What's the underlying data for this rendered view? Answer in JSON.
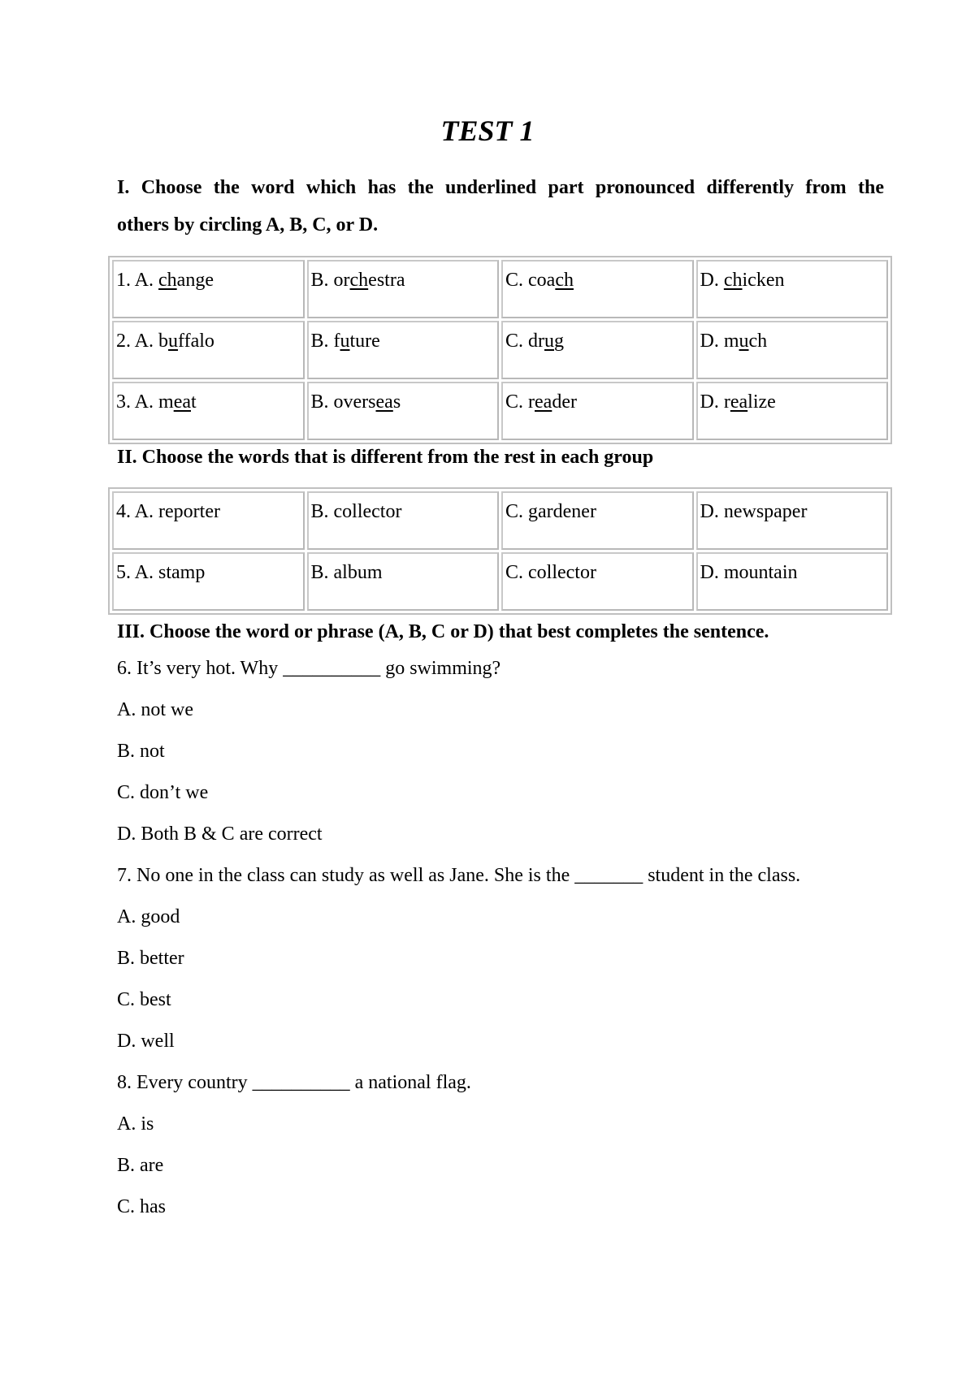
{
  "title": "TEST 1",
  "section1": {
    "heading_line1": "I. Choose the word which has the underlined part pronounced differently from the",
    "heading_line2": "others by circling A, B, C, or D.",
    "rows": [
      [
        {
          "prefix": "1. A. ",
          "pre": "",
          "u": "ch",
          "post": "ange"
        },
        {
          "prefix": "B. ",
          "pre": "or",
          "u": "ch",
          "post": "estra"
        },
        {
          "prefix": "C. ",
          "pre": "coa",
          "u": "ch",
          "post": ""
        },
        {
          "prefix": "D. ",
          "pre": "",
          "u": "ch",
          "post": "icken"
        }
      ],
      [
        {
          "prefix": "2. A. ",
          "pre": "b",
          "u": "u",
          "post": "ffalo"
        },
        {
          "prefix": "B. ",
          "pre": "f",
          "u": "u",
          "post": "ture"
        },
        {
          "prefix": "C. ",
          "pre": "dr",
          "u": "u",
          "post": "g"
        },
        {
          "prefix": "D. ",
          "pre": "m",
          "u": "u",
          "post": "ch"
        }
      ],
      [
        {
          "prefix": "3. A. ",
          "pre": "m",
          "u": "ea",
          "post": "t"
        },
        {
          "prefix": "B. ",
          "pre": "overs",
          "u": "ea",
          "post": "s"
        },
        {
          "prefix": "C. ",
          "pre": "r",
          "u": "ea",
          "post": "der"
        },
        {
          "prefix": "D. ",
          "pre": "r",
          "u": "ea",
          "post": "lize"
        }
      ]
    ]
  },
  "section2": {
    "heading": "II. Choose the words that is different from the rest in each group",
    "rows": [
      [
        "4. A. reporter",
        "B. collector",
        "C. gardener",
        "D. newspaper"
      ],
      [
        "5. A. stamp",
        "B. album",
        "C. collector",
        "D. mountain"
      ]
    ]
  },
  "section3": {
    "heading": "III. Choose the word or phrase (A, B, C or D) that best completes the sentence.",
    "lines": [
      "6. It’s very hot. Why __________ go swimming?",
      "A. not we",
      "B. not",
      "C. don’t we",
      "D. Both B & C are correct",
      "7. No one in the class can study as well as Jane. She is the _______ student in the class.",
      "A. good",
      "B. better",
      "C. best",
      "D. well",
      "8. Every country __________ a national flag.",
      "A. is",
      "B. are",
      "C. has"
    ]
  }
}
